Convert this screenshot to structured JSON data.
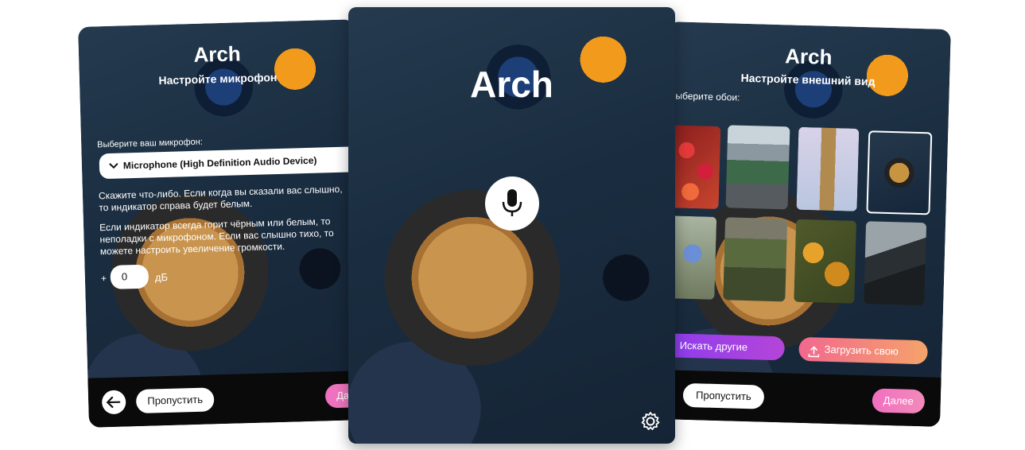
{
  "left_screen": {
    "app_title": "Arch",
    "subtitle": "Настройте микрофон",
    "select_label": "Выберите ваш микрофон:",
    "selected_device": "Microphone (High Definition Audio Device)",
    "hint_1": "Скажите что-либо. Если когда вы сказали вас слышно, то индикатор справа будет белым.",
    "hint_2": "Если индикатор всегда горит чёрным или белым, то неполадки с микрофоном. Если вас слышно тихо, то можете настроить увеличение громкости.",
    "gain_sign": "+",
    "gain_value": "0",
    "gain_unit": "дБ",
    "skip_label": "Пропустить",
    "next_label": "Далее"
  },
  "center_screen": {
    "app_title": "Arch"
  },
  "right_screen": {
    "app_title": "Arch",
    "subtitle": "Настройте внешний вид",
    "wallpaper_label": "Выберите обои:",
    "search_label": "Искать другие",
    "upload_label": "Загрузить свою",
    "skip_label": "Пропустить",
    "next_label": "Далее"
  }
}
